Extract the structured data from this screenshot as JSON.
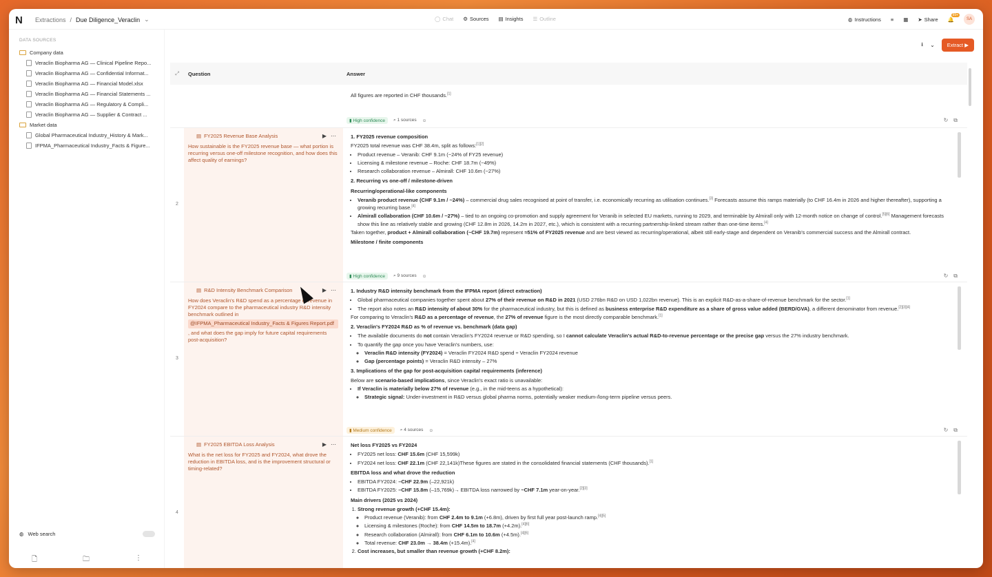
{
  "app": {
    "logo": "N",
    "crumb_root": "Extractions",
    "crumb_sep": "/",
    "crumb_current": "Due Diligence_Veraclin"
  },
  "nav": {
    "chat": "Chat",
    "sources": "Sources",
    "insights": "Insights",
    "outline": "Outline"
  },
  "right_nav": {
    "instructions": "Instructions",
    "share": "Share",
    "notif_count": "99+",
    "avatar": "SA"
  },
  "sidebar": {
    "heading": "DATA SOURCES",
    "folders": [
      {
        "name": "Company data",
        "files": [
          "Veraclin Biopharma AG — Clinical Pipeline Repo...",
          "Veraclin Biopharma AG — Confidential Informat...",
          "Veraclin Biopharma AG — Financial Model.xlsx",
          "Veraclin Biopharma AG — Financial Statements ...",
          "Veraclin Biopharma AG — Regulatory & Compli...",
          "Veraclin Biopharma AG — Supplier & Contract ..."
        ]
      },
      {
        "name": "Market data",
        "files": [
          "Global Pharmaceutical Industry_History & Mark...",
          "IFPMA_Pharmaceutical Industry_Facts & Figure..."
        ]
      }
    ],
    "web_search": "Web search"
  },
  "toolbar": {
    "extract": "Extract"
  },
  "table": {
    "col_question": "Question",
    "col_answer": "Answer"
  },
  "row1": {
    "answer": "All figures are reported in CHF thousands.",
    "sup": "[1]",
    "confidence": "High confidence",
    "sources": "1  sources"
  },
  "row2": {
    "num": "2",
    "title": "FY2025 Revenue Base Analysis",
    "question": "How sustainable is the FY2025 revenue base — what portion is recurring versus one-off milestone recognition, and how does this affect quality of earnings?",
    "confidence": "High confidence",
    "sources": "9  sources"
  },
  "row3": {
    "num": "3",
    "title": "R&D Intensity Benchmark Comparison",
    "question_a": "How does Veraclin's R&D spend as a percentage of revenue in FY2024 compare to the pharmaceutical industry R&D intensity benchmark outlined in",
    "mention": "@IFPMA_Pharmaceutical Industry_Facts & Figures Report.pdf",
    "question_b": ", and what does the gap imply for future capital requirements post-acquisition?",
    "confidence": "Medium confidence",
    "sources": "4  sources"
  },
  "row4": {
    "num": "4",
    "title": "FY2025 EBITDA Loss Analysis",
    "question": "What is the net loss for FY2025 and FY2024, what drove the reduction in EBITDA loss, and is the improvement structural or timing-related?"
  }
}
